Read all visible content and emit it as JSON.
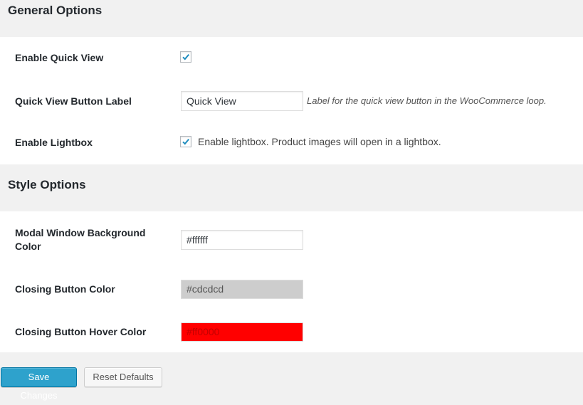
{
  "general": {
    "title": "General Options",
    "enable_quick_view": {
      "label": "Enable Quick View",
      "checked": true
    },
    "button_label": {
      "label": "Quick View Button Label",
      "value": "Quick View",
      "description": "Label for the quick view button in the WooCommerce loop."
    },
    "enable_lightbox": {
      "label": "Enable Lightbox",
      "checked": true,
      "description": "Enable lightbox. Product images will open in a lightbox."
    }
  },
  "style": {
    "title": "Style Options",
    "modal_bg": {
      "label": "Modal Window Background Color",
      "value": "#ffffff"
    },
    "closing_btn": {
      "label": "Closing Button Color",
      "value": "#cdcdcd"
    },
    "closing_btn_hover": {
      "label": "Closing Button Hover Color",
      "value": "#ff0000"
    }
  },
  "actions": {
    "save_label": "Save Changes",
    "reset_label": "Reset Defaults"
  },
  "colors": {
    "checkmark": "#1e8cbe",
    "primary_button": "#2ea2cc"
  }
}
